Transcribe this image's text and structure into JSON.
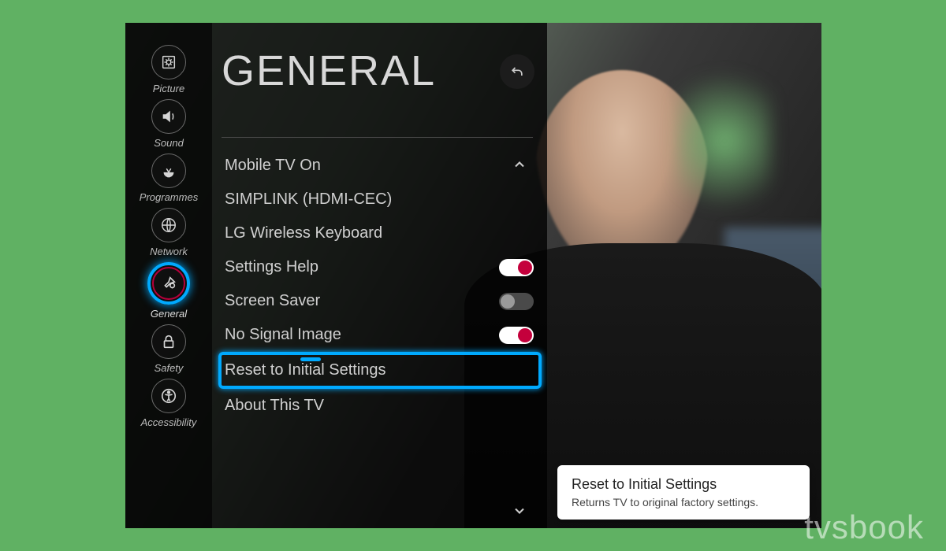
{
  "header": {
    "title": "GENERAL"
  },
  "sidebar": {
    "items": [
      {
        "label": "Picture"
      },
      {
        "label": "Sound"
      },
      {
        "label": "Programmes"
      },
      {
        "label": "Network"
      },
      {
        "label": "General"
      },
      {
        "label": "Safety"
      },
      {
        "label": "Accessibility"
      }
    ]
  },
  "settings": {
    "items": [
      {
        "label": "Mobile TV On",
        "control": "none"
      },
      {
        "label": "SIMPLINK (HDMI-CEC)",
        "control": "none"
      },
      {
        "label": "LG Wireless Keyboard",
        "control": "none"
      },
      {
        "label": "Settings Help",
        "control": "toggle-on"
      },
      {
        "label": "Screen Saver",
        "control": "toggle-off"
      },
      {
        "label": "No Signal Image",
        "control": "toggle-on"
      },
      {
        "label": "Reset to Initial Settings",
        "control": "none",
        "highlighted": true
      },
      {
        "label": "About This TV",
        "control": "none"
      }
    ]
  },
  "tooltip": {
    "title": "Reset to Initial Settings",
    "body": "Returns TV to original factory settings."
  },
  "watermark": "tvsbook"
}
